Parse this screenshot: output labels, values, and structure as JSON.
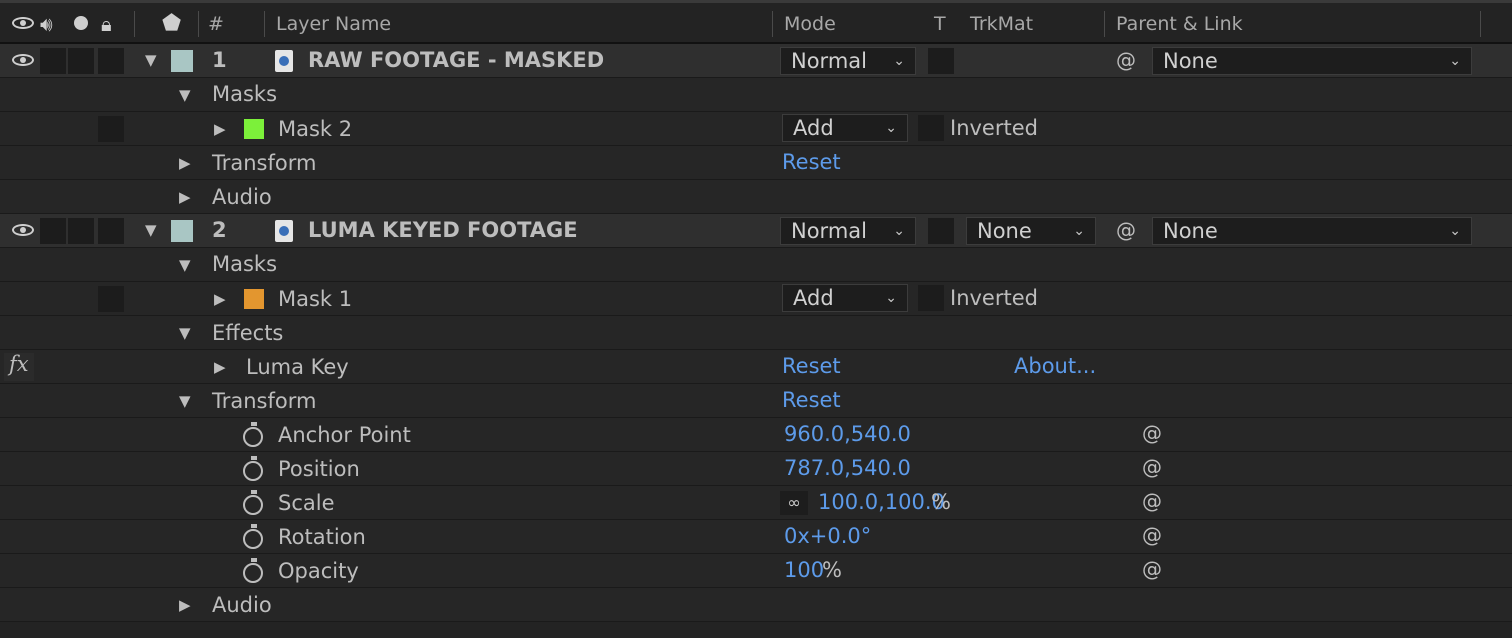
{
  "header": {
    "hash": "#",
    "layer_name": "Layer Name",
    "mode": "Mode",
    "t": "T",
    "trkmat": "TrkMat",
    "parent_link": "Parent & Link"
  },
  "layers": [
    {
      "number": "1",
      "name": "RAW FOOTAGE - MASKED",
      "mode": "Normal",
      "parent": "None",
      "masks_label": "Masks",
      "mask": {
        "name": "Mask 2",
        "mode": "Add",
        "inverted": "Inverted",
        "color": "#7cf03a"
      },
      "transform_label": "Transform",
      "transform_reset": "Reset",
      "audio_label": "Audio",
      "label_color": "#a9c6c4"
    },
    {
      "number": "2",
      "name": "LUMA KEYED FOOTAGE",
      "mode": "Normal",
      "trkmat": "None",
      "parent": "None",
      "masks_label": "Masks",
      "mask": {
        "name": "Mask 1",
        "mode": "Add",
        "inverted": "Inverted",
        "color": "#e3962f"
      },
      "effects_label": "Effects",
      "effect": {
        "fx": "fx",
        "name": "Luma Key",
        "reset": "Reset",
        "about": "About..."
      },
      "transform_label": "Transform",
      "transform_reset": "Reset",
      "properties": [
        {
          "name": "Anchor Point",
          "value": "960.0,540.0"
        },
        {
          "name": "Position",
          "value": "787.0,540.0"
        },
        {
          "name": "Scale",
          "value": "100.0,100.0",
          "unit": "%"
        },
        {
          "name": "Rotation",
          "value": "0x+0.0°"
        },
        {
          "name": "Opacity",
          "value": "100",
          "unit": "%"
        }
      ],
      "audio_label": "Audio",
      "label_color": "#a9c6c4"
    }
  ],
  "icons": {
    "eye": "eye-icon",
    "audio": "speaker-icon",
    "solo": "solo-dot-icon",
    "lock": "lock-icon",
    "label": "tag-icon",
    "expand": "triangle-down-icon",
    "collapse": "triangle-right-icon",
    "stopwatch": "stopwatch-icon",
    "pickwhip": "pickwhip-spiral-icon",
    "link": "constrain-link-icon",
    "chevron": "chevron-down-icon"
  },
  "colors": {
    "background": "#232323",
    "layer_row": "#2f2f2f",
    "value_blue": "#5d9bea"
  }
}
